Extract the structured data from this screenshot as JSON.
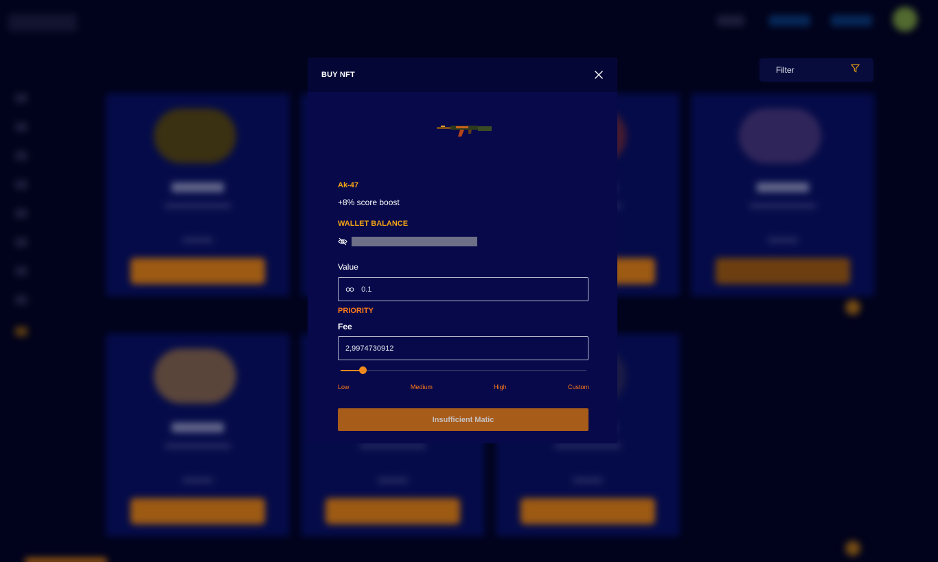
{
  "filter": {
    "label": "Filter"
  },
  "modal": {
    "title": "BUY NFT",
    "nft": {
      "name": "Ak-47",
      "perk": "+8% score boost"
    },
    "wallet": {
      "label": "WALLET BALANCE"
    },
    "value": {
      "label": "Value",
      "input_value": "0.1"
    },
    "priority": {
      "label": "PRIORITY",
      "fee_label": "Fee",
      "fee_value": "2,9974730912",
      "slider_fraction": 0.09,
      "options": [
        "Low",
        "Medium",
        "High",
        "Custom"
      ]
    },
    "submit_label": "Insufficient Matic"
  },
  "colors": {
    "accent": "#f08a1e",
    "gold": "#f4a414",
    "priority": "#ff7a1a",
    "modal_bg": "#07094a",
    "page_bg": "#03052b"
  },
  "icons": {
    "close": "close-icon",
    "filter": "filter-funnel-icon",
    "eye": "eye-hidden-icon",
    "value": "matic-icon"
  }
}
